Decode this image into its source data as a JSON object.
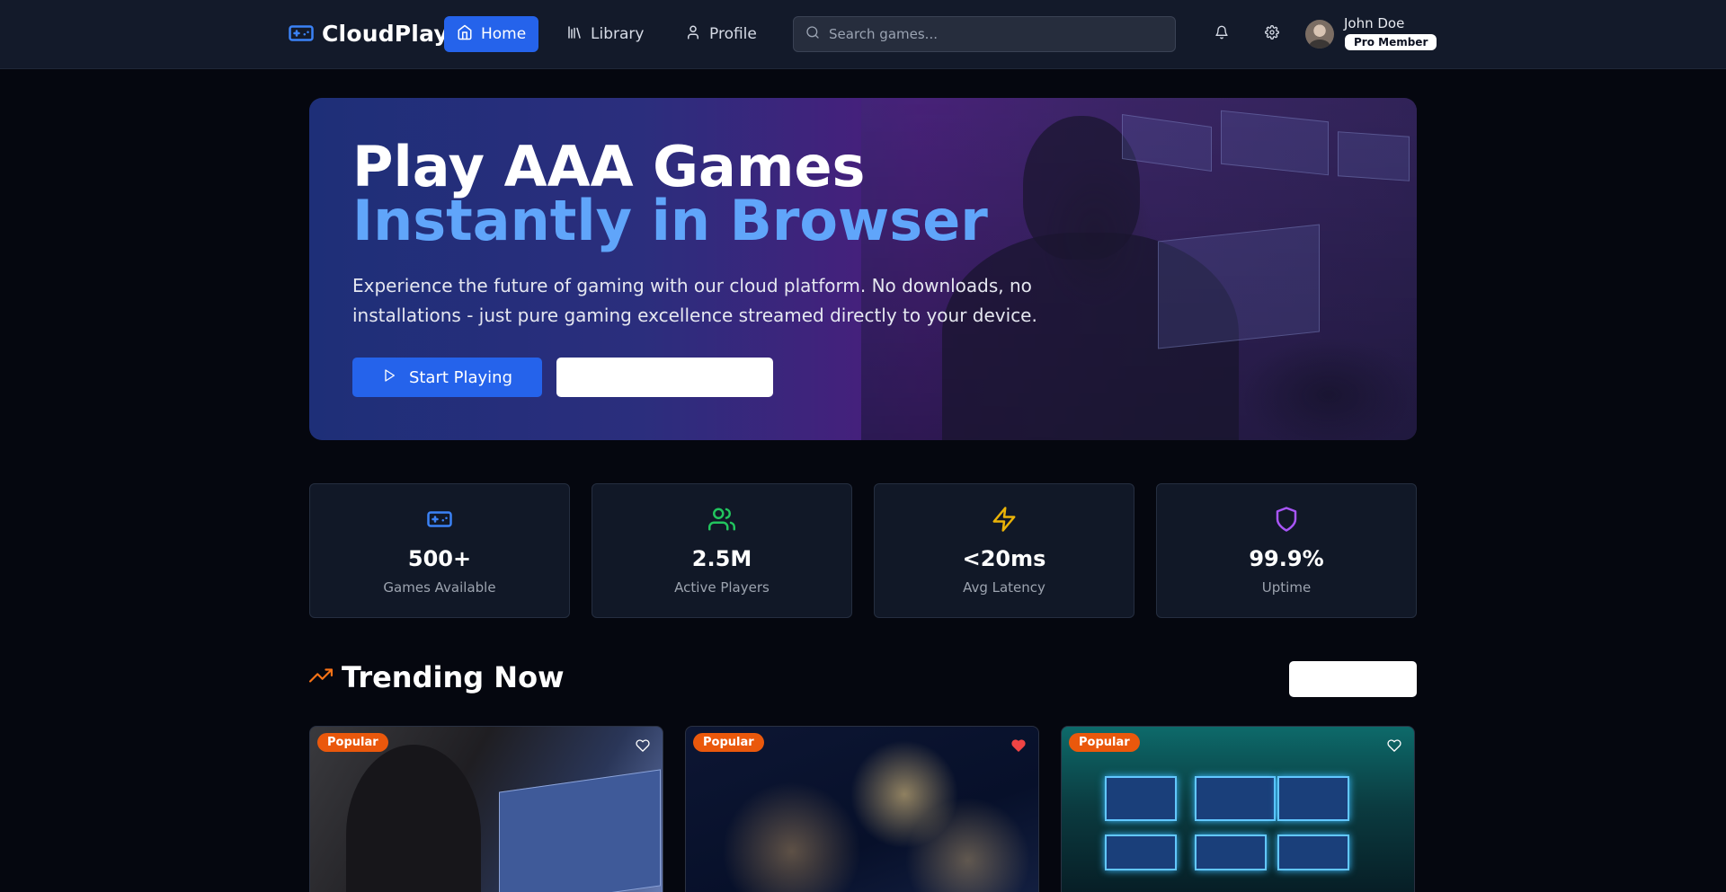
{
  "nav": {
    "brand": "CloudPlay",
    "links": [
      {
        "label": "Home",
        "icon": "home-icon",
        "active": true
      },
      {
        "label": "Library",
        "icon": "library-icon",
        "active": false
      },
      {
        "label": "Profile",
        "icon": "user-icon",
        "active": false
      }
    ],
    "search_placeholder": "Search games...",
    "user": {
      "name": "John Doe",
      "badge": "Pro Member"
    }
  },
  "hero": {
    "title_line1": "Play AAA Games",
    "title_line2": "Instantly in Browser",
    "subtitle": "Experience the future of gaming with our cloud platform. No downloads, no installations - just pure gaming excellence streamed directly to your device.",
    "primary_button": "Start Playing",
    "secondary_button": ""
  },
  "stats": [
    {
      "value": "500+",
      "label": "Games Available",
      "icon": "gamepad-icon",
      "color": "#3b82f6"
    },
    {
      "value": "2.5M",
      "label": "Active Players",
      "icon": "users-icon",
      "color": "#22c55e"
    },
    {
      "value": "<20ms",
      "label": "Avg Latency",
      "icon": "lightning-icon",
      "color": "#eab308"
    },
    {
      "value": "99.9%",
      "label": "Uptime",
      "icon": "shield-icon",
      "color": "#a855f7"
    }
  ],
  "trending": {
    "title": "Trending Now",
    "cards": [
      {
        "badge": "Popular",
        "favorited": false
      },
      {
        "badge": "Popular",
        "favorited": true
      },
      {
        "badge": "Popular",
        "favorited": false
      }
    ]
  },
  "colors": {
    "accent": "#2563eb",
    "hero_title_accent": "#60a5fa",
    "badge": "#ea580c",
    "trend_icon": "#f97316",
    "heart_active": "#ef4444"
  }
}
